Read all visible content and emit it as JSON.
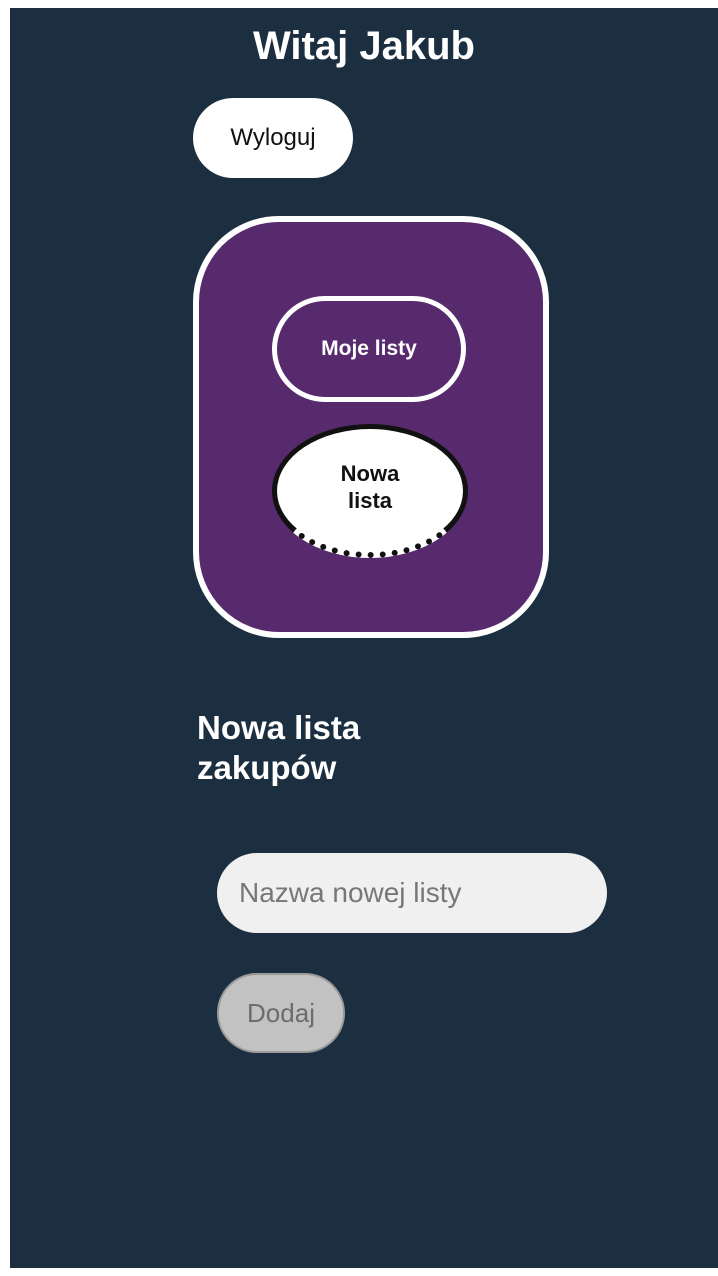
{
  "header": {
    "greeting": "Witaj Jakub",
    "logout_label": "Wyloguj"
  },
  "nav": {
    "my_lists_label": "Moje listy",
    "new_list_label": "Nowa lista"
  },
  "new_list_form": {
    "title": "Nowa lista zakupów",
    "name_value": "",
    "name_placeholder": "Nazwa nowej listy",
    "add_label": "Dodaj"
  },
  "colors": {
    "page_background": "#1c2f40",
    "nav_card": "#572a6e",
    "text_light": "#ffffff",
    "input_background": "#f0f0f0",
    "disabled_button": "#c2c2c2"
  }
}
